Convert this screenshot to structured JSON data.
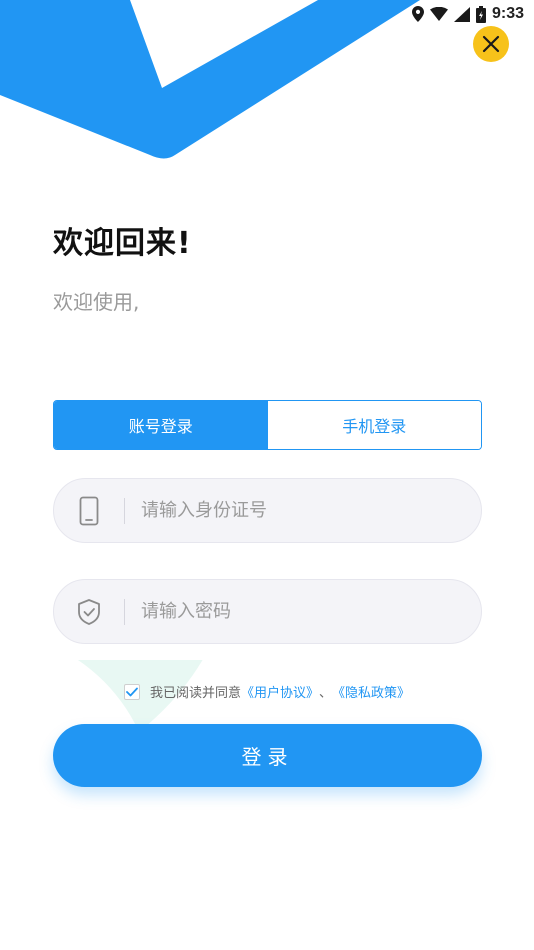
{
  "status_bar": {
    "time": "9:33",
    "icons": [
      "location-icon",
      "wifi-icon",
      "signal-icon",
      "battery-icon"
    ]
  },
  "close_icon": "close-icon",
  "welcome": {
    "title": "欢迎回来!",
    "subtitle": "欢迎使用,"
  },
  "tabs": [
    {
      "label": "账号登录",
      "active": true
    },
    {
      "label": "手机登录",
      "active": false
    }
  ],
  "fields": {
    "id_number": {
      "placeholder": "请输入身份证号",
      "value": "",
      "icon": "phone-icon"
    },
    "password": {
      "placeholder": "请输入密码",
      "value": "",
      "icon": "shield-check-icon"
    }
  },
  "agreement": {
    "checked": true,
    "text": "我已阅读并同意",
    "user_agreement": "《用户协议》",
    "separator": "、",
    "privacy_policy": "《隐私政策》"
  },
  "login_button": "登录",
  "colors": {
    "primary": "#2196f3",
    "close_bg": "#f7c21a",
    "field_bg": "#f4f4f8",
    "deco_mint": "#e8f8f3"
  }
}
